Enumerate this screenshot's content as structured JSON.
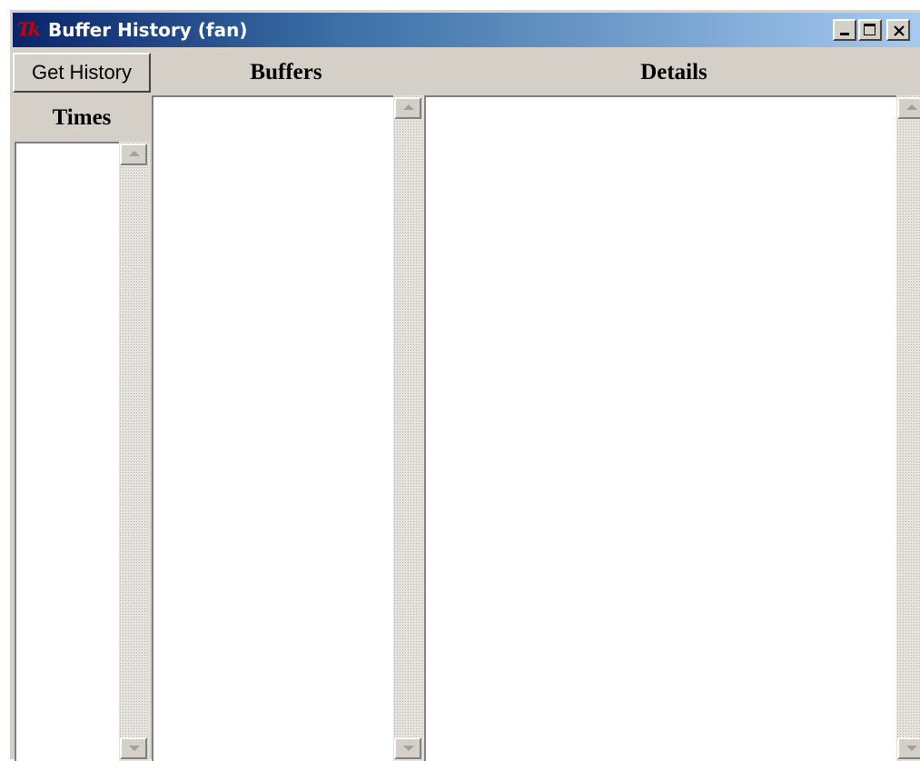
{
  "window": {
    "title": "Buffer History (fan)",
    "app_icon": "tk-logo-icon",
    "app_icon_text": "Tk"
  },
  "caption_buttons": {
    "minimize": "minimize-icon",
    "maximize": "maximize-icon",
    "close": "close-icon"
  },
  "toolbar": {
    "get_history_label": "Get History"
  },
  "panes": {
    "times": {
      "heading": "Times",
      "items": []
    },
    "buffers": {
      "heading": "Buffers",
      "items": []
    },
    "details": {
      "heading": "Details",
      "items": []
    }
  },
  "colors": {
    "titlebar_start": "#0a246a",
    "titlebar_end": "#a6caf0",
    "face": "#d4d0c8",
    "list_background": "#ffffff",
    "tk_logo": "#cc0000"
  }
}
